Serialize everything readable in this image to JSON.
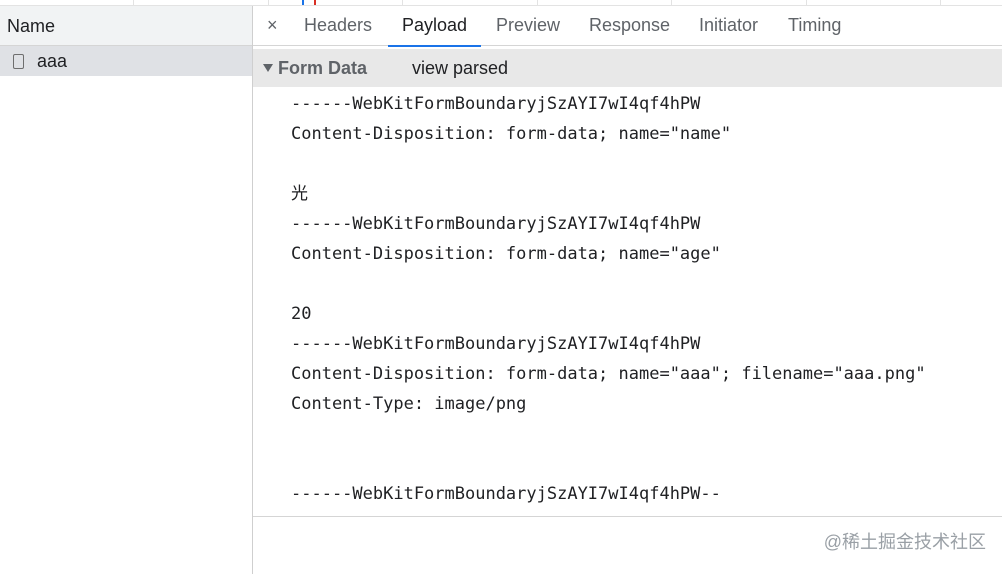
{
  "request_list": {
    "column_header": "Name",
    "requests": [
      {
        "name": "aaa",
        "icon": "document-icon"
      }
    ]
  },
  "details": {
    "close_label": "×",
    "tabs": [
      "Headers",
      "Payload",
      "Preview",
      "Response",
      "Initiator",
      "Timing"
    ],
    "active_tab": "Payload",
    "section": {
      "title": "Form Data",
      "toggle_label": "view parsed",
      "expanded": true
    },
    "payload_lines": [
      "------WebKitFormBoundaryjSzAYI7wI4qf4hPW",
      "Content-Disposition: form-data; name=\"name\"",
      "",
      "光",
      "------WebKitFormBoundaryjSzAYI7wI4qf4hPW",
      "Content-Disposition: form-data; name=\"age\"",
      "",
      "20",
      "------WebKitFormBoundaryjSzAYI7wI4qf4hPW",
      "Content-Disposition: form-data; name=\"aaa\"; filename=\"aaa.png\"",
      "Content-Type: image/png",
      "",
      "",
      "------WebKitFormBoundaryjSzAYI7wI4qf4hPW--"
    ]
  },
  "watermark": "@稀土掘金技术社区",
  "colors": {
    "accent": "#1a73e8",
    "selected_row": "#dfe1e5",
    "section_header": "#e8e8e8"
  }
}
